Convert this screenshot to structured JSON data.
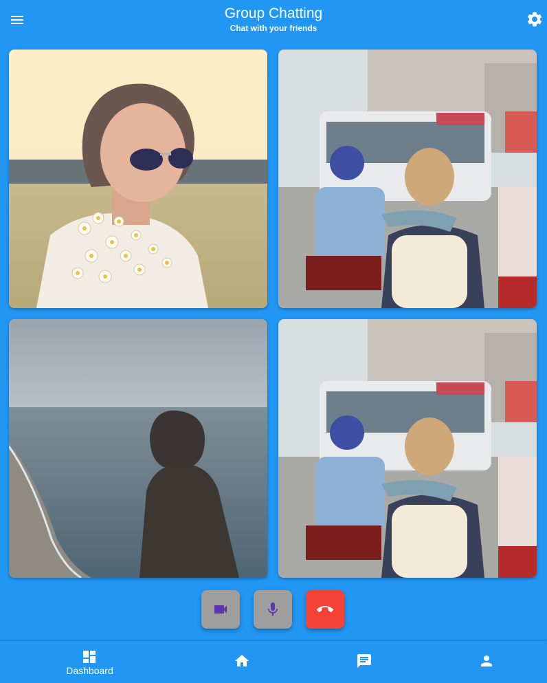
{
  "app": {
    "title": "Group Chatting",
    "subtitle": "Chat with your friends"
  },
  "icons": {
    "menu": "menu-icon",
    "settings": "gear-icon",
    "video": "videocam-icon",
    "mic": "mic-icon",
    "end_call": "call-end-icon"
  },
  "participants": [
    {
      "scene": "woman with sunglasses holding daisies in a field"
    },
    {
      "scene": "street with bus and scooters, person with backpack"
    },
    {
      "scene": "hooded person looking at the sea"
    },
    {
      "scene": "street with bus and scooters, person with backpack"
    }
  ],
  "controls": [
    {
      "name": "video",
      "color": "#9e9e9e",
      "icon_color": "#5e35b1"
    },
    {
      "name": "mic",
      "color": "#9e9e9e",
      "icon_color": "#5e35b1"
    },
    {
      "name": "end-call",
      "color": "#f44336",
      "icon_color": "#ffffff"
    }
  ],
  "bottom_nav": [
    {
      "label": "Dashboard",
      "icon": "dashboard-icon",
      "active": true
    },
    {
      "label": "",
      "icon": "home-icon",
      "active": false
    },
    {
      "label": "",
      "icon": "chat-icon",
      "active": false
    },
    {
      "label": "",
      "icon": "person-icon",
      "active": false
    }
  ],
  "colors": {
    "primary": "#2196f3",
    "end_call": "#f44336",
    "control_gray": "#9e9e9e",
    "control_icon": "#5e35b1"
  }
}
